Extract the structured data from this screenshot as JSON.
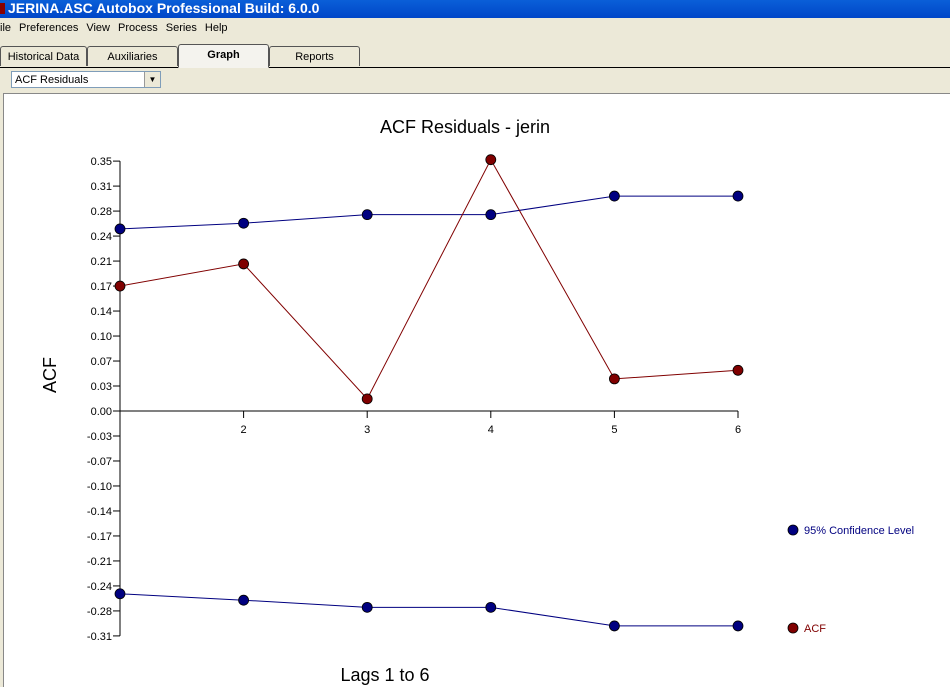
{
  "window": {
    "title": "JERINA.ASC  Autobox Professional Build: 6.0.0"
  },
  "menu": [
    "ile",
    "Preferences",
    "View",
    "Process",
    "Series",
    "Help"
  ],
  "tabs": [
    {
      "label": "Historical Data"
    },
    {
      "label": "Auxiliaries"
    },
    {
      "label": "Graph",
      "active": true
    },
    {
      "label": "Reports"
    }
  ],
  "graph_select": {
    "value": "ACF Residuals"
  },
  "chart_data": {
    "type": "line",
    "title": "ACF Residuals - jerin",
    "xlabel": "Lags  1 to 6",
    "ylabel": "ACF",
    "x": [
      1,
      2,
      3,
      4,
      5,
      6
    ],
    "x_tick_labels": [
      "2",
      "3",
      "4",
      "5",
      "6"
    ],
    "y_tick_labels": [
      "0.35",
      "0.31",
      "0.28",
      "0.24",
      "0.21",
      "0.17",
      "0.14",
      "0.10",
      "0.07",
      "0.03",
      "0.00",
      "-0.03",
      "-0.07",
      "-0.10",
      "-0.14",
      "-0.17",
      "-0.21",
      "-0.24",
      "-0.28",
      "-0.31"
    ],
    "ylim": [
      -0.315,
      0.35
    ],
    "grid": false,
    "legend_placement": "right",
    "series": [
      {
        "name": "95% Confidence Level",
        "color": "#000080",
        "values": [
          0.255,
          0.263,
          0.275,
          0.275,
          0.301,
          0.301
        ]
      },
      {
        "name": "95% Confidence Level",
        "color": "#000080",
        "values": [
          -0.256,
          -0.265,
          -0.275,
          -0.275,
          -0.301,
          -0.301
        ],
        "legend": false
      },
      {
        "name": "ACF",
        "color": "#800000",
        "values": [
          0.175,
          0.206,
          0.017,
          0.352,
          0.045,
          0.057
        ]
      }
    ]
  }
}
